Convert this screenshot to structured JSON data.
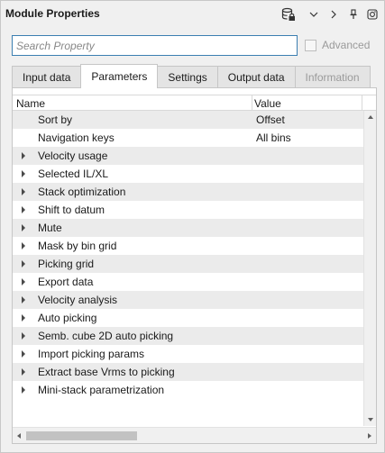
{
  "window": {
    "title": "Module Properties",
    "toolbar_icons": [
      "database-lock-icon",
      "chevron-down-icon",
      "chevron-right-icon",
      "pin-icon",
      "camera-icon"
    ]
  },
  "search": {
    "placeholder": "Search Property",
    "value": ""
  },
  "advanced": {
    "label": "Advanced",
    "checked": false,
    "enabled": false
  },
  "tabs": [
    {
      "label": "Input data",
      "active": false,
      "enabled": true
    },
    {
      "label": "Parameters",
      "active": true,
      "enabled": true
    },
    {
      "label": "Settings",
      "active": false,
      "enabled": true
    },
    {
      "label": "Output data",
      "active": false,
      "enabled": true
    },
    {
      "label": "Information",
      "active": false,
      "enabled": false
    }
  ],
  "table": {
    "columns": [
      "Name",
      "Value"
    ],
    "rows": [
      {
        "name": "Sort by",
        "value": "Offset",
        "expandable": false
      },
      {
        "name": "Navigation keys",
        "value": "All bins",
        "expandable": false
      },
      {
        "name": "Velocity usage",
        "value": "",
        "expandable": true
      },
      {
        "name": "Selected IL/XL",
        "value": "",
        "expandable": true
      },
      {
        "name": "Stack optimization",
        "value": "",
        "expandable": true
      },
      {
        "name": "Shift to datum",
        "value": "",
        "expandable": true
      },
      {
        "name": "Mute",
        "value": "",
        "expandable": true
      },
      {
        "name": "Mask by bin grid",
        "value": "",
        "expandable": true
      },
      {
        "name": "Picking grid",
        "value": "",
        "expandable": true
      },
      {
        "name": "Export data",
        "value": "",
        "expandable": true
      },
      {
        "name": "Velocity analysis",
        "value": "",
        "expandable": true
      },
      {
        "name": "Auto picking",
        "value": "",
        "expandable": true
      },
      {
        "name": "Semb. cube 2D auto picking",
        "value": "",
        "expandable": true
      },
      {
        "name": "Import picking params",
        "value": "",
        "expandable": true
      },
      {
        "name": "Extract base Vrms to picking",
        "value": "",
        "expandable": true
      },
      {
        "name": "Mini-stack parametrization",
        "value": "",
        "expandable": true
      }
    ]
  },
  "colors": {
    "accent_border": "#3c7fb1",
    "row_alt": "#ebebeb",
    "panel_bg": "#f0f0f0"
  }
}
